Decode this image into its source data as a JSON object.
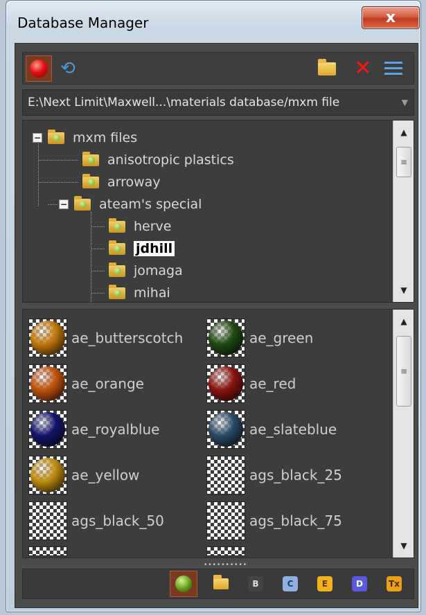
{
  "window": {
    "title": "Database Manager",
    "close_glyph": "x"
  },
  "toolbar": {
    "buttons": [
      {
        "name": "record-button",
        "icon": "red-dot-icon",
        "active": true
      },
      {
        "name": "refresh-button",
        "icon": "refresh-icon"
      },
      {
        "name": "open-folder-button",
        "icon": "folder-icon"
      },
      {
        "name": "delete-button",
        "icon": "close-icon"
      },
      {
        "name": "list-view-button",
        "icon": "list-icon"
      }
    ]
  },
  "path": {
    "value": "E:\\Next Limit\\Maxwell...\\materials database/mxm file"
  },
  "tree": {
    "nodes": [
      {
        "label": "mxm files",
        "level": 0,
        "expanded": true
      },
      {
        "label": "anisotropic plastics",
        "level": 1
      },
      {
        "label": "arroway",
        "level": 1
      },
      {
        "label": "ateam's special",
        "level": 1,
        "expanded": true
      },
      {
        "label": "herve",
        "level": 2
      },
      {
        "label": "jdhill",
        "level": 2,
        "selected": true
      },
      {
        "label": "jomaga",
        "level": 2
      },
      {
        "label": "mihai",
        "level": 2
      }
    ],
    "expander_glyph": "−"
  },
  "materials": [
    {
      "name": "ae_butterscotch",
      "color": "#c2790c"
    },
    {
      "name": "ae_green",
      "color": "#1f4a12"
    },
    {
      "name": "ae_orange",
      "color": "#c2520f"
    },
    {
      "name": "ae_red",
      "color": "#8c1410"
    },
    {
      "name": "ae_royalblue",
      "color": "#13156a"
    },
    {
      "name": "ae_slateblue",
      "color": "#2b4a66"
    },
    {
      "name": "ae_yellow",
      "color": "#c08c10"
    },
    {
      "name": "ags_black_25",
      "color": ""
    },
    {
      "name": "ags_black_50",
      "color": ""
    },
    {
      "name": "ags_black_75",
      "color": ""
    }
  ],
  "scroll": {
    "up_glyph": "▲",
    "down_glyph": "▼",
    "thumb_glyph": "≡"
  },
  "bottombar": {
    "buttons": [
      {
        "name": "materials-tab",
        "icon": "green-sphere-icon",
        "active": true
      },
      {
        "name": "folder-tab",
        "icon": "folder-icon"
      },
      {
        "name": "b-tab",
        "label": "B",
        "color": "#444444",
        "text": "#dddddd"
      },
      {
        "name": "c-tab",
        "label": "C",
        "color": "#8fb0e0",
        "text": "#1b3c75"
      },
      {
        "name": "e-tab",
        "label": "E",
        "color": "#f2b21b",
        "text": "#5a3a00"
      },
      {
        "name": "d-tab",
        "label": "D",
        "color": "#5a5ae0",
        "text": "#ffffff"
      },
      {
        "name": "tx-tab",
        "label": "Tx",
        "color": "#e8a21a",
        "text": "#4a2a00"
      }
    ]
  }
}
